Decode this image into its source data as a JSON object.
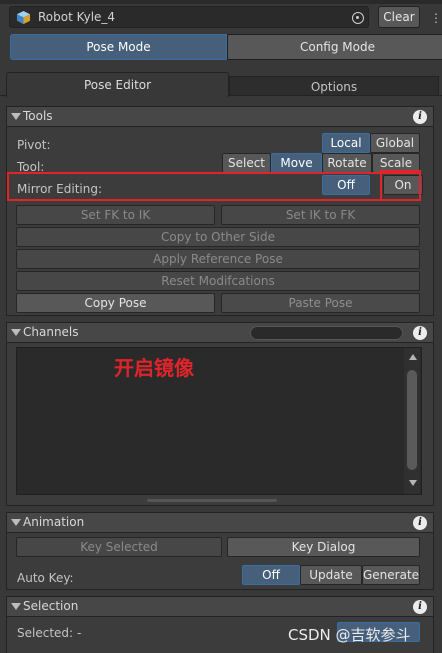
{
  "object": {
    "name": "Robot Kyle_4",
    "clear_label": "Clear",
    "picker_icon": "object-picker-icon",
    "cube_icon": "prefab-cube-icon"
  },
  "modes": {
    "pose": "Pose Mode",
    "config": "Config Mode",
    "active": "Pose Mode"
  },
  "tabs": {
    "pose_editor": "Pose Editor",
    "options": "Options"
  },
  "tools": {
    "title": "Tools",
    "pivot": {
      "label": "Pivot:",
      "options": [
        "Local",
        "Global"
      ],
      "selected": "Local"
    },
    "tool": {
      "label": "Tool:",
      "options": [
        "Select",
        "Move",
        "Rotate",
        "Scale"
      ],
      "selected": "Move"
    },
    "mirror": {
      "label": "Mirror Editing:",
      "options": [
        "Off",
        "On"
      ],
      "selected": "Off"
    },
    "buttons": {
      "set_fk_to_ik": "Set FK to IK",
      "set_ik_to_fk": "Set IK to FK",
      "copy_other_side": "Copy to Other Side",
      "apply_reference": "Apply Reference Pose",
      "reset_modifications": "Reset Modifcations",
      "copy_pose": "Copy Pose",
      "paste_pose": "Paste Pose"
    }
  },
  "channels": {
    "title": "Channels",
    "search_value": "",
    "annotation": "开启镜像"
  },
  "animation": {
    "title": "Animation",
    "key_selected": "Key Selected",
    "key_dialog": "Key Dialog",
    "auto_key": {
      "label": "Auto Key:",
      "options": [
        "Off",
        "Update",
        "Generate"
      ],
      "selected": "Off"
    }
  },
  "selection": {
    "title": "Selection",
    "selected_label": "Selected:",
    "selected_value": "-"
  },
  "watermark": "CSDN @吉软参斗",
  "colors": {
    "accent": "#46607c",
    "highlight": "#e0242a",
    "panel": "#3c3c3c"
  }
}
